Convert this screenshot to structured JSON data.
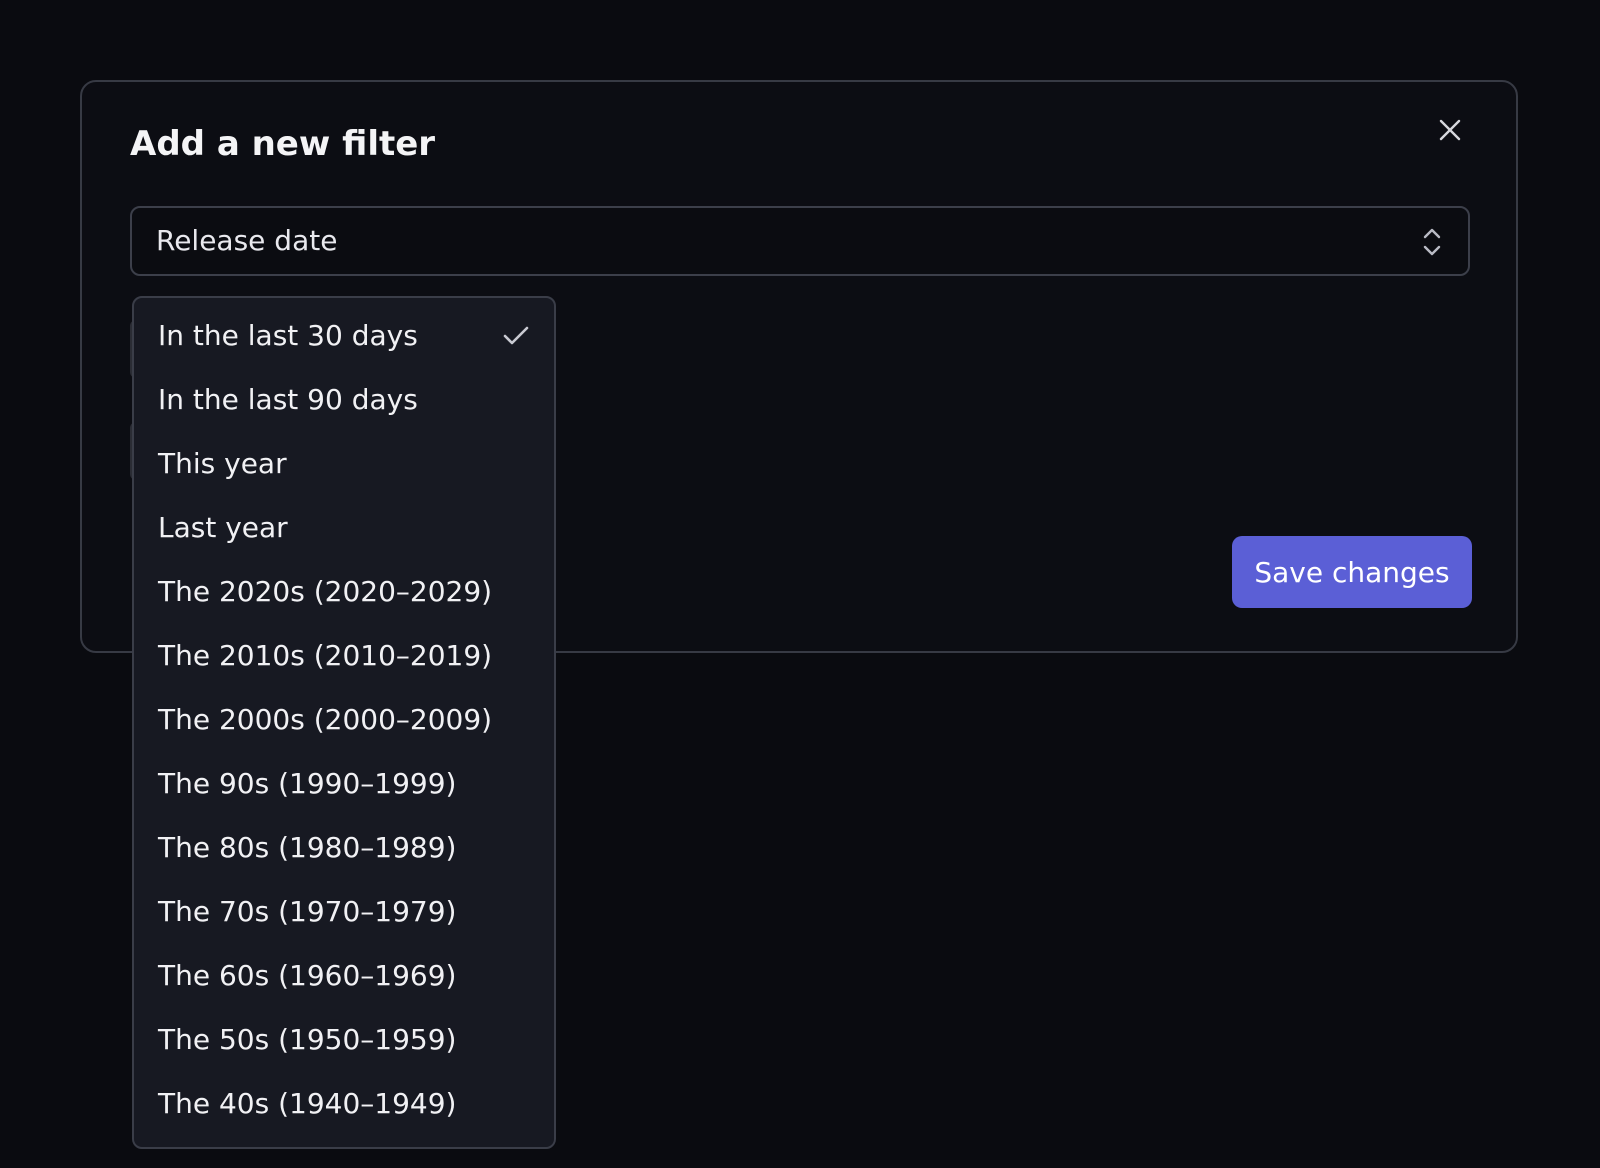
{
  "modal": {
    "title": "Add a new filter",
    "close_icon": "close-icon"
  },
  "filter_select": {
    "value": "Release date",
    "icon": "chevron-up-down-icon"
  },
  "dropdown": {
    "selected_index": 0,
    "check_icon": "checkmark-icon",
    "options": [
      "In the last 30 days",
      "In the last 90 days",
      "This year",
      "Last year",
      "The 2020s (2020–2029)",
      "The 2010s (2010–2019)",
      "The 2000s (2000–2009)",
      "The 90s (1990–1999)",
      "The 80s (1980–1989)",
      "The 70s (1970–1979)",
      "The 60s (1960–1969)",
      "The 50s (1950–1959)",
      "The 40s (1940–1949)"
    ]
  },
  "footer": {
    "save_label": "Save changes"
  },
  "colors": {
    "background": "#0a0b10",
    "modal_border": "#373a44",
    "accent": "#5b5fd6",
    "dropdown_bg": "#171922"
  }
}
